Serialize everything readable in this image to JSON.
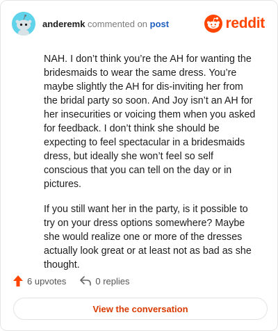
{
  "header": {
    "username": "anderemk",
    "action_text": "commented on",
    "post_link": "post",
    "logo_text": "reddit"
  },
  "comment": {
    "paragraphs": [
      "NAH. I don’t think you’re the AH for wanting the bridesmaids to wear the same dress. You’re maybe slightly the AH for dis-inviting her from the bridal party so soon. And Joy isn’t an AH for her insecurities or voicing them when you asked for feedback. I don’t think she should be expecting to feel spectacular in a bridesmaids dress, but ideally she won’t feel so self conscious that you can tell on the day or in pictures.",
      "If you still want her in the party, is it possible to try on your dress options somewhere? Maybe she would realize one or more of the dresses actually look great or at least not as bad as she thought."
    ]
  },
  "actions": {
    "upvotes": "6 upvotes",
    "replies": "0 replies"
  },
  "footer": {
    "view_button": "View the conversation"
  },
  "colors": {
    "brand": "#ff4500",
    "link": "#1f5fbf",
    "avatar_bg": "#5fd3ea"
  },
  "icons": [
    "snoo-avatar-icon",
    "reddit-logo-icon",
    "upvote-arrow-icon",
    "reply-arrow-icon"
  ]
}
